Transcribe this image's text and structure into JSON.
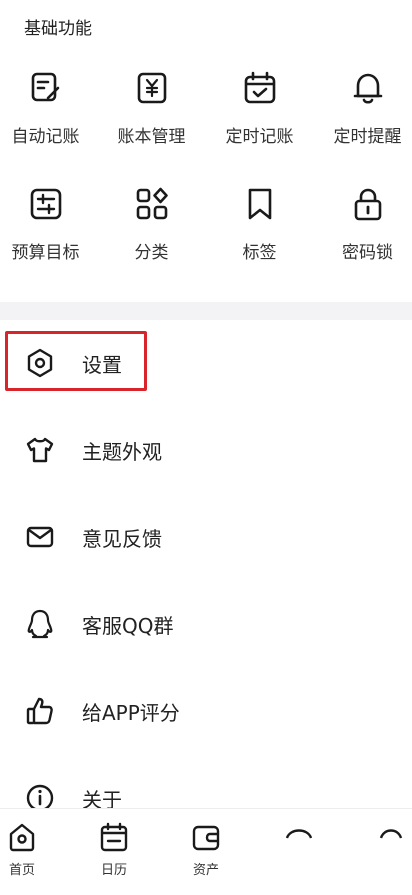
{
  "basic_section": {
    "title": "基础功能",
    "items": [
      {
        "label": "自动记账",
        "icon": "auto-record-icon"
      },
      {
        "label": "账本管理",
        "icon": "yen-ledger-icon"
      },
      {
        "label": "定时记账",
        "icon": "calendar-check-icon"
      },
      {
        "label": "定时提醒",
        "icon": "bell-icon"
      },
      {
        "label": "预算目标",
        "icon": "budget-slider-icon"
      },
      {
        "label": "分类",
        "icon": "category-grid-icon"
      },
      {
        "label": "标签",
        "icon": "bookmark-icon"
      },
      {
        "label": "密码锁",
        "icon": "lock-icon"
      }
    ]
  },
  "settings_list": [
    {
      "label": "设置",
      "icon": "hexagon-settings-icon"
    },
    {
      "label": "主题外观",
      "icon": "tshirt-icon"
    },
    {
      "label": "意见反馈",
      "icon": "mail-icon"
    },
    {
      "label": "客服QQ群",
      "icon": "qq-penguin-icon"
    },
    {
      "label": "给APP评分",
      "icon": "thumbs-up-icon"
    },
    {
      "label": "关于",
      "icon": "info-icon"
    }
  ],
  "bottom_nav": [
    {
      "label": "首页",
      "icon": "home-icon"
    },
    {
      "label": "日历",
      "icon": "calendar-icon"
    },
    {
      "label": "资产",
      "icon": "wallet-icon"
    }
  ],
  "colors": {
    "highlight_border": "#d9242b",
    "icon_stroke": "#1a1a1a"
  }
}
